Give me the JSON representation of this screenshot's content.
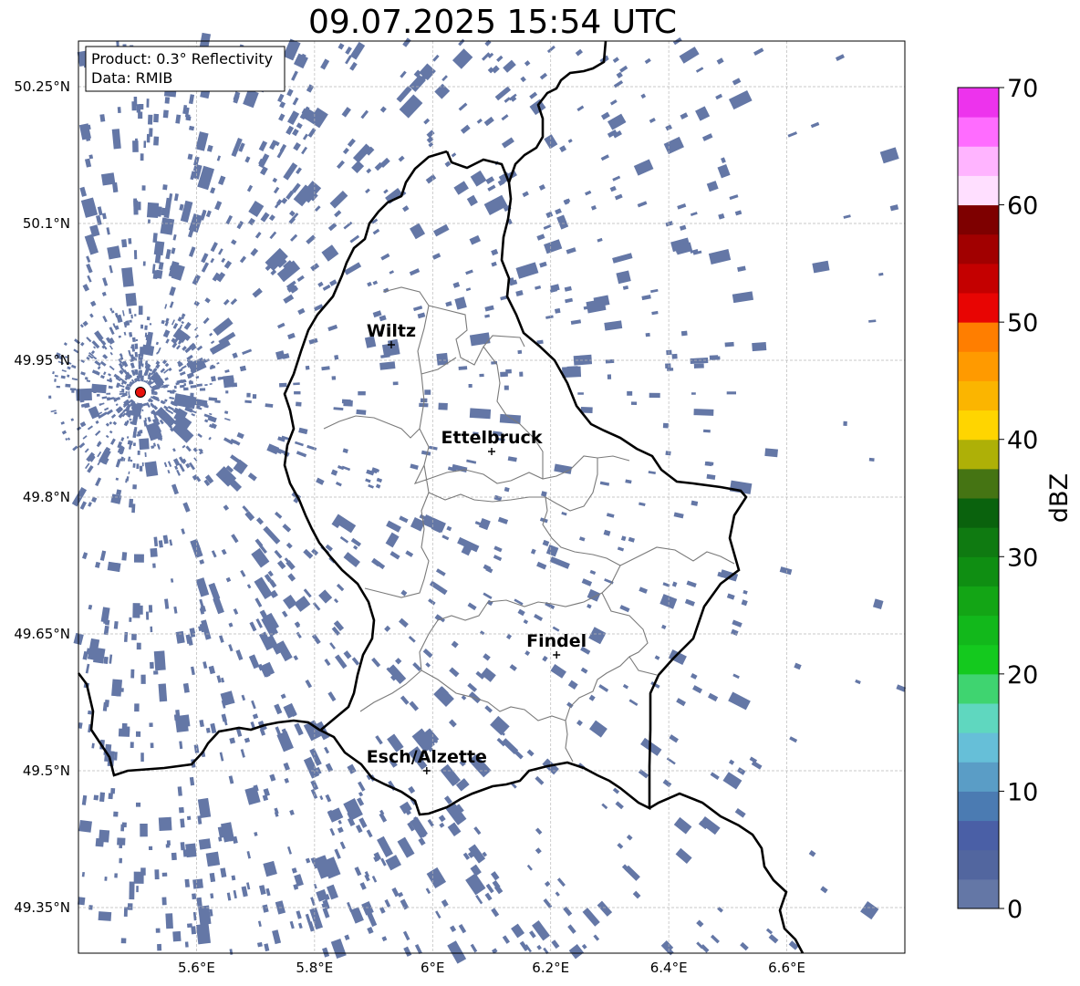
{
  "title": "09.07.2025 15:54 UTC",
  "info_box": {
    "product": "Product: 0.3° Reflectivity",
    "data": "Data: RMIB"
  },
  "map": {
    "lon_range": [
      5.4,
      6.8
    ],
    "lat_range": [
      49.3,
      50.3
    ],
    "lon_ticks": [
      {
        "value": 5.6,
        "label": "5.6°E"
      },
      {
        "value": 5.8,
        "label": "5.8°E"
      },
      {
        "value": 6.0,
        "label": "6°E"
      },
      {
        "value": 6.2,
        "label": "6.2°E"
      },
      {
        "value": 6.4,
        "label": "6.4°E"
      },
      {
        "value": 6.6,
        "label": "6.6°E"
      }
    ],
    "lat_ticks": [
      {
        "value": 50.25,
        "label": "50.25°N"
      },
      {
        "value": 50.1,
        "label": "50.1°N"
      },
      {
        "value": 49.95,
        "label": "49.95°N"
      },
      {
        "value": 49.8,
        "label": "49.8°N"
      },
      {
        "value": 49.65,
        "label": "49.65°N"
      },
      {
        "value": 49.5,
        "label": "49.5°N"
      },
      {
        "value": 49.35,
        "label": "49.35°N"
      }
    ],
    "grid": true,
    "radar_site": {
      "lon": 5.505,
      "lat": 49.915,
      "color": "#e8120c"
    },
    "cities": [
      {
        "name": "Wiltz",
        "lon": 5.93,
        "lat": 49.967
      },
      {
        "name": "Ettelbruck",
        "lon": 6.1,
        "lat": 49.85
      },
      {
        "name": "Findel",
        "lon": 6.21,
        "lat": 49.627
      },
      {
        "name": "Esch/Alzette",
        "lon": 5.99,
        "lat": 49.5
      }
    ],
    "echo_color": "#6477a6"
  },
  "colorbar": {
    "label": "dBZ",
    "min": 0,
    "max": 70,
    "ticks": [
      0,
      10,
      20,
      30,
      40,
      50,
      60,
      70
    ],
    "colors": [
      "#6477a6",
      "#52669f",
      "#4a5fa6",
      "#4b7bb2",
      "#5a9dc6",
      "#66bfd8",
      "#5fd7bf",
      "#3fd470",
      "#14c91e",
      "#12b81b",
      "#13a515",
      "#0f8e12",
      "#0f7a11",
      "#0a620d",
      "#457413",
      "#aeb007",
      "#ffd500",
      "#fbb500",
      "#ff9a00",
      "#ff7e00",
      "#e80503",
      "#c40000",
      "#a10000",
      "#7e0000",
      "#ffdfff",
      "#ffb4ff",
      "#ff6cff",
      "#ed33ed"
    ]
  }
}
